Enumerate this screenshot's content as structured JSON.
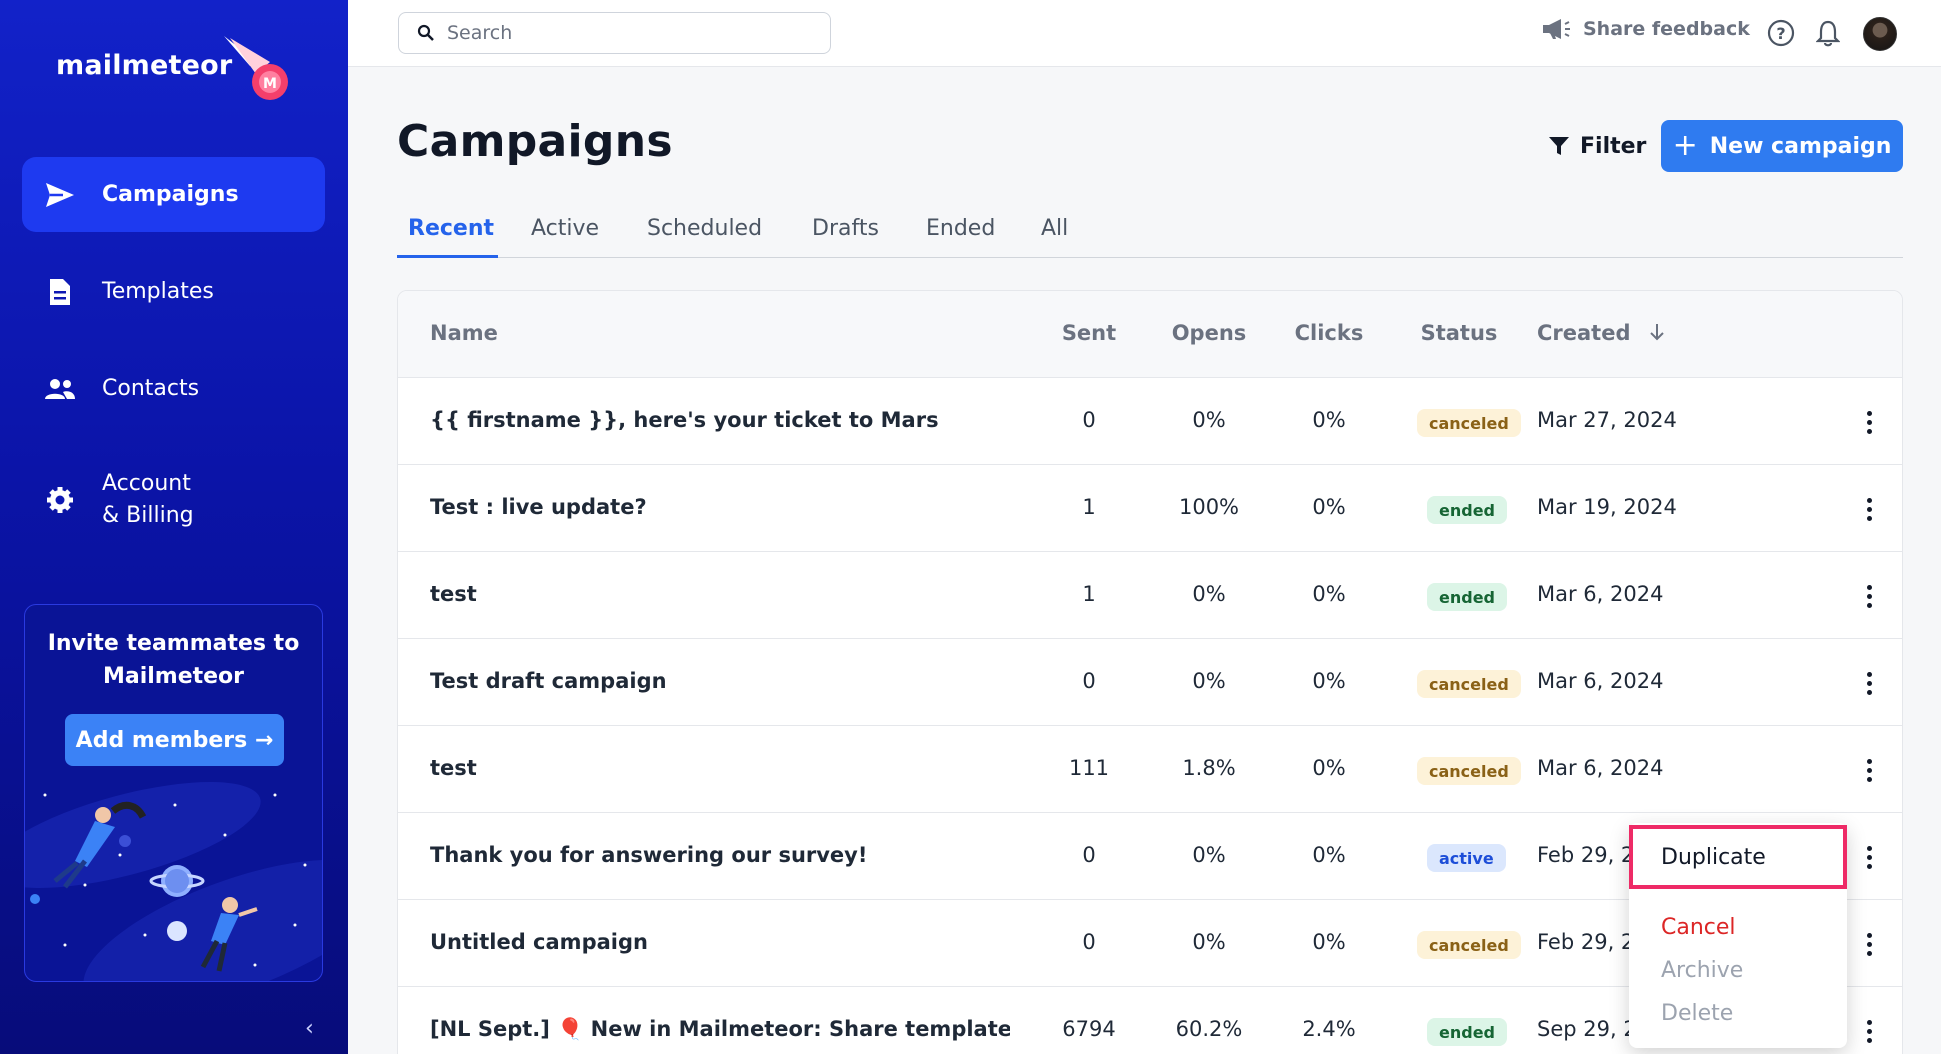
{
  "app": {
    "logo_text": "mailmeteor"
  },
  "sidebar": {
    "items": [
      {
        "label": "Campaigns",
        "icon": "send-icon",
        "active": true
      },
      {
        "label": "Templates",
        "icon": "document-icon",
        "active": false
      },
      {
        "label": "Contacts",
        "icon": "people-icon",
        "active": false
      },
      {
        "label": "Account\n& Billing",
        "icon": "gear-icon",
        "active": false
      }
    ],
    "invite": {
      "title": "Invite teammates to\nMailmeteor",
      "button": "Add members →"
    },
    "collapse": "‹"
  },
  "topbar": {
    "search_placeholder": "Search",
    "share_feedback": "Share feedback"
  },
  "main": {
    "title": "Campaigns",
    "filter_label": "Filter",
    "new_campaign_label": "New campaign",
    "tabs": [
      "Recent",
      "Active",
      "Scheduled",
      "Drafts",
      "Ended",
      "All"
    ],
    "active_tab": "Recent"
  },
  "table": {
    "columns": [
      "Name",
      "Sent",
      "Opens",
      "Clicks",
      "Status",
      "Created"
    ],
    "sort_icon": "arrow-down-icon",
    "rows": [
      {
        "name": "{{ firstname }}, here's your ticket to Mars",
        "sent": "0",
        "opens": "0%",
        "clicks": "0%",
        "status": "canceled",
        "created": "Mar 27, 2024"
      },
      {
        "name": "Test : live update?",
        "sent": "1",
        "opens": "100%",
        "clicks": "0%",
        "status": "ended",
        "created": "Mar 19, 2024"
      },
      {
        "name": "test",
        "sent": "1",
        "opens": "0%",
        "clicks": "0%",
        "status": "ended",
        "created": "Mar 6, 2024"
      },
      {
        "name": "Test draft campaign",
        "sent": "0",
        "opens": "0%",
        "clicks": "0%",
        "status": "canceled",
        "created": "Mar 6, 2024"
      },
      {
        "name": "test",
        "sent": "111",
        "opens": "1.8%",
        "clicks": "0%",
        "status": "canceled",
        "created": "Mar 6, 2024"
      },
      {
        "name": "Thank you for answering our survey!",
        "sent": "0",
        "opens": "0%",
        "clicks": "0%",
        "status": "active",
        "created": "Feb 29, 2"
      },
      {
        "name": "Untitled campaign",
        "sent": "0",
        "opens": "0%",
        "clicks": "0%",
        "status": "canceled",
        "created": "Feb 29, 2"
      },
      {
        "name": "[NL Sept.] 🎈 New in Mailmeteor: Share templates, sa",
        "sent": "6794",
        "opens": "60.2%",
        "clicks": "2.4%",
        "status": "ended",
        "created": "Sep 29, 2"
      }
    ]
  },
  "context_menu": {
    "items": [
      {
        "label": "Duplicate",
        "highlighted": true
      },
      {
        "label": "Cancel"
      },
      {
        "label": "Archive"
      },
      {
        "label": "Delete"
      }
    ]
  },
  "colors": {
    "sidebar_bg": "#0b14a8",
    "primary": "#2f7bf0",
    "active_tab": "#2563eb",
    "highlight": "#ee2a66",
    "danger": "#dc2626"
  }
}
